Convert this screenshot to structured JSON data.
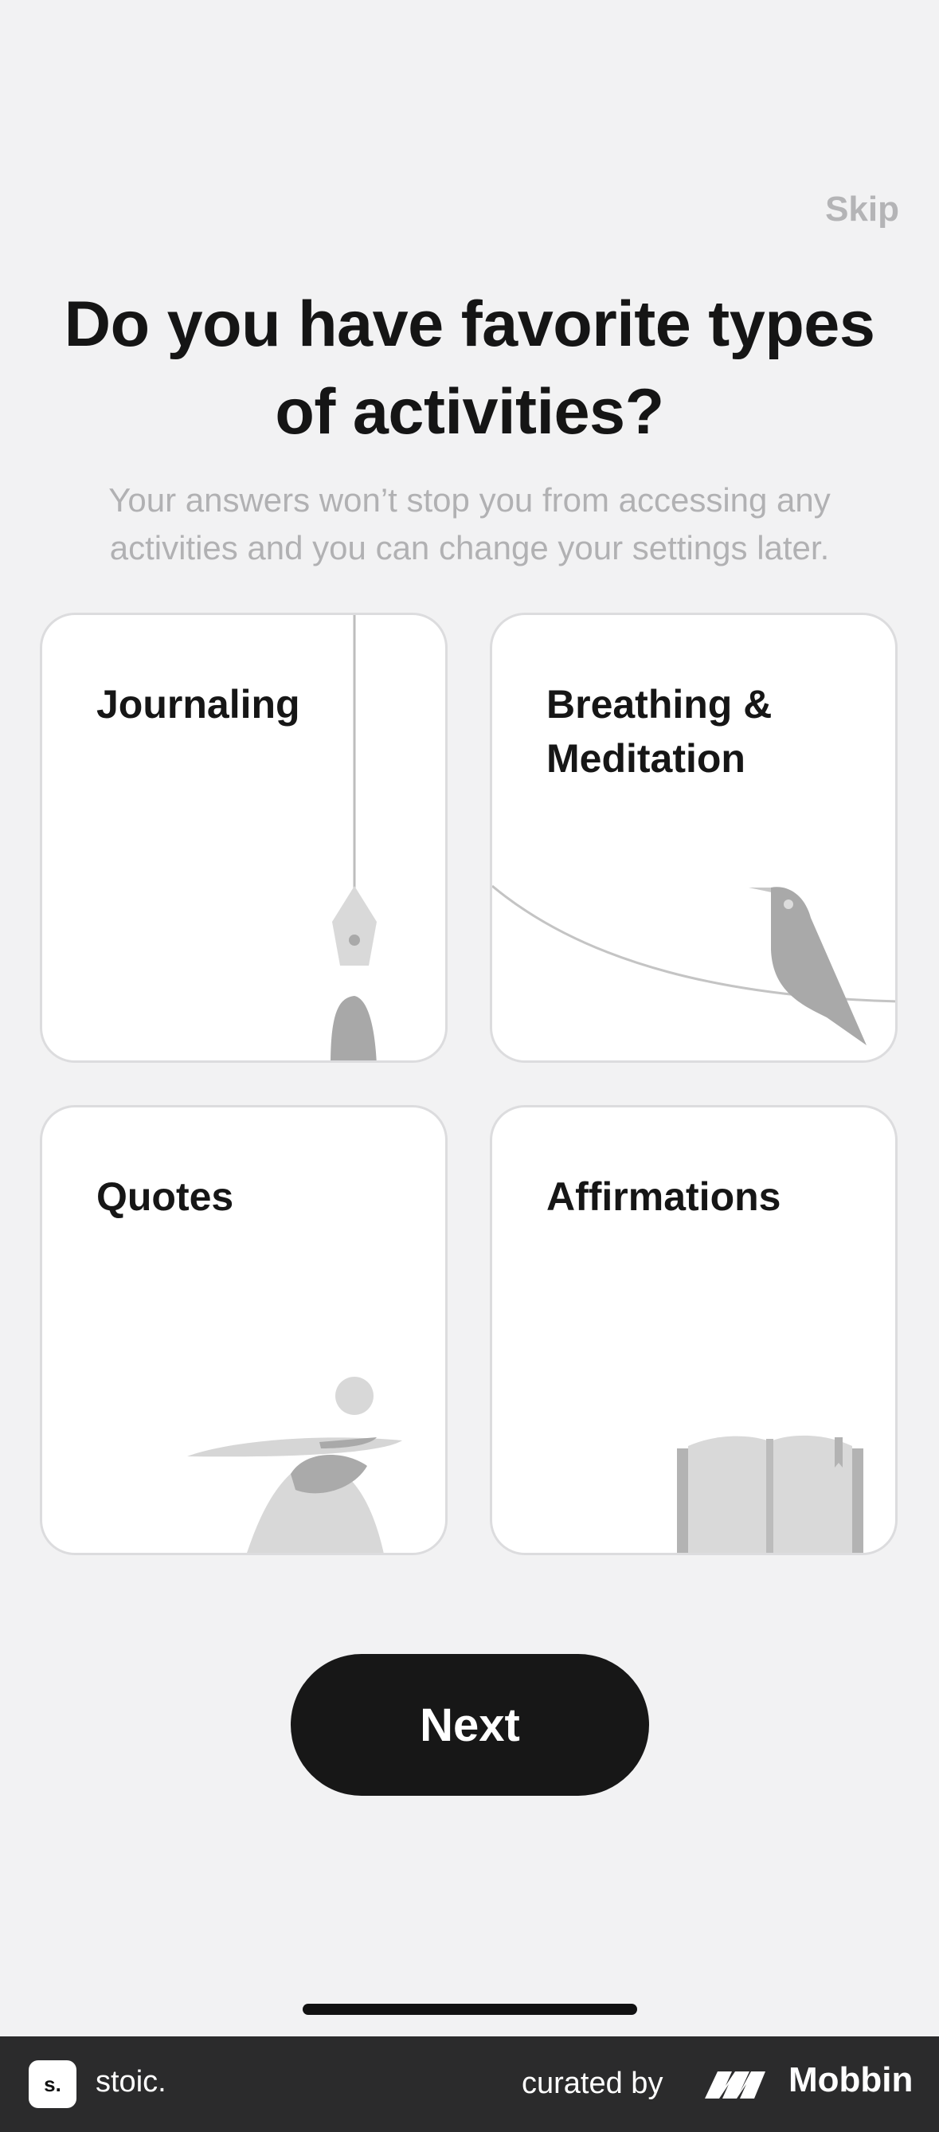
{
  "header": {
    "skip_label": "Skip"
  },
  "question": {
    "title": "Do you have favorite types of activities?",
    "subtitle": "Your answers won’t stop you from accessing any activities and you can change your settings later."
  },
  "cards": [
    {
      "label": "Journaling",
      "illustration": "pen-nib-icon"
    },
    {
      "label": "Breathing & Meditation",
      "illustration": "bird-icon"
    },
    {
      "label": "Quotes",
      "illustration": "balance-figure-icon"
    },
    {
      "label": "Affirmations",
      "illustration": "book-icon"
    }
  ],
  "actions": {
    "next_label": "Next"
  },
  "footer": {
    "app_logo_text": "s.",
    "app_name": "stoic.",
    "curated_by": "curated by",
    "brand": "Mobbin"
  },
  "colors": {
    "background": "#f2f2f3",
    "card": "#ffffff",
    "primary_button": "#171717",
    "muted_text": "#b1b1b3"
  }
}
